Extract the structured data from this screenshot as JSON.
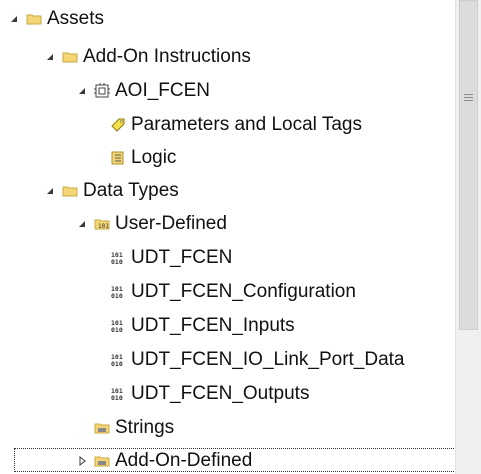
{
  "tree": {
    "assets": "Assets",
    "aoi_folder": "Add-On Instructions",
    "aoi_item": "AOI_FCEN",
    "parameters": "Parameters and Local Tags",
    "logic": "Logic",
    "data_types": "Data Types",
    "user_defined": "User-Defined",
    "udt_items": [
      "UDT_FCEN",
      "UDT_FCEN_Configuration",
      "UDT_FCEN_Inputs",
      "UDT_FCEN_IO_Link_Port_Data",
      "UDT_FCEN_Outputs"
    ],
    "strings": "Strings",
    "add_on_defined": "Add-On-Defined"
  },
  "icons": {
    "expanded": "triangle-down-right-icon",
    "collapsed": "triangle-right-icon",
    "folder": "folder-icon",
    "aoi": "aoi-icon",
    "tag": "tag-icon",
    "logic": "logic-icon",
    "udt": "binary-icon",
    "datatype_folder": "datatype-folder-icon"
  },
  "colors": {
    "folder": "#f5d675",
    "tag": "#e8c400",
    "scroll_thumb": "#dcdcdc"
  }
}
